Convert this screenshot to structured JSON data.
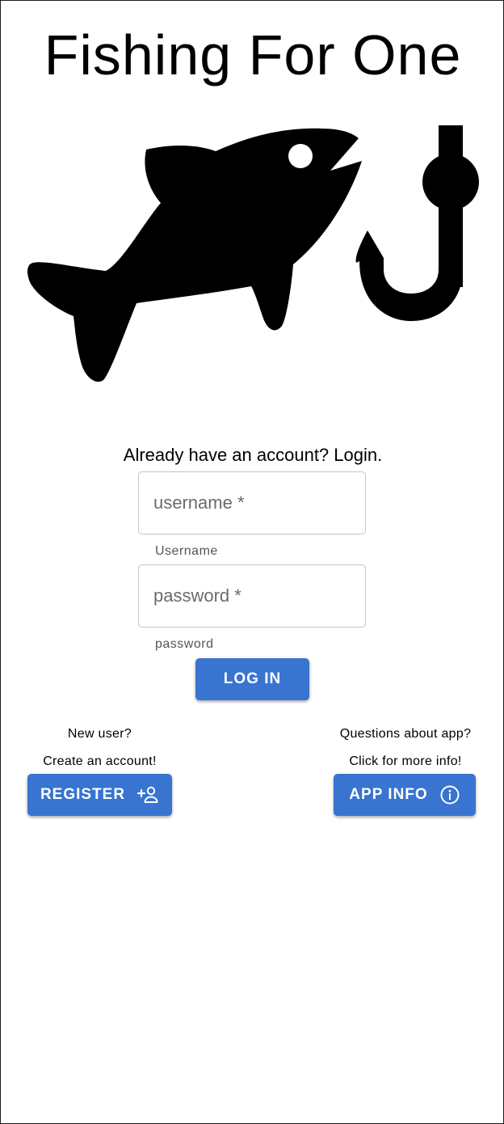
{
  "app": {
    "title": "Fishing For One"
  },
  "logo": {
    "icon": "fish-with-hook-icon"
  },
  "login": {
    "heading": "Already have an account? Login.",
    "username": {
      "placeholder": "username *",
      "value": "",
      "helper": "Username"
    },
    "password": {
      "placeholder": "password *",
      "value": "",
      "helper": "password"
    },
    "submit_label": "LOG IN"
  },
  "register": {
    "prompt_line1": "New user?",
    "prompt_line2": "Create an account!",
    "button_label": "REGISTER",
    "icon": "add-person-icon"
  },
  "info": {
    "prompt_line1": "Questions about app?",
    "prompt_line2": "Click for more info!",
    "button_label": "APP INFO",
    "icon": "info-circle-icon"
  },
  "colors": {
    "primary": "#3874d0",
    "text": "#000000",
    "helper": "#555555",
    "field_border": "#c4c4c4"
  }
}
